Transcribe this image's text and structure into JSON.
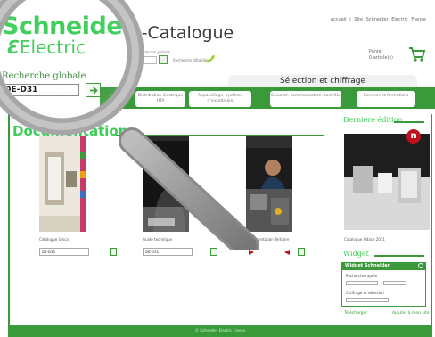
{
  "header": {
    "brand_name": "Schneider",
    "brand_sub": "Electric",
    "brand_mark": "Ɛ",
    "catalog_title": "e-Catalogue",
    "top_links": "Accueil  |  Site Schneider Electric France",
    "cart_label": "Panier",
    "cart_count": "0 article(s)",
    "mini_search_label": "Recherche globale",
    "mini_search_detail": "Recherche détaillée"
  },
  "search": {
    "label": "Recherche globale",
    "value": "DE-D31"
  },
  "nav": {
    "selection_tab": "Sélection et chiffrage",
    "items": [
      {
        "label": "Distribution électrique HTA"
      },
      {
        "label": "Appareillage, système d'installation"
      },
      {
        "label": "Sécurité, communication, contrôle"
      },
      {
        "label": "Services et formations"
      }
    ]
  },
  "main": {
    "section_title": "Documentation",
    "books": [
      {
        "caption": "Catalogue Unica",
        "ref": "DE-D31"
      },
      {
        "caption": "Guide technique",
        "ref": "DE-D31"
      },
      {
        "caption": "Documentation Tertiaire",
        "ref": ""
      }
    ]
  },
  "last_edition": {
    "title": "Dernière édition",
    "badge": "n",
    "caption": "Catalogue Odace 2011"
  },
  "widget": {
    "title": "Widget",
    "head_label": "Widget Schneider",
    "line1": "Recherche rapide",
    "line2": "Chiffrage et sélection",
    "download": "Télécharger",
    "add": "Ajouter à mon site"
  },
  "footer": {
    "text": "© Schneider Electric France"
  },
  "colors": {
    "brand_green": "#3dcd58",
    "nav_green": "#3a9a3a",
    "badge_red": "#c0101e"
  },
  "icons": [
    "go-arrow-icon",
    "cart-icon",
    "play-icon",
    "magnifier-icon"
  ]
}
